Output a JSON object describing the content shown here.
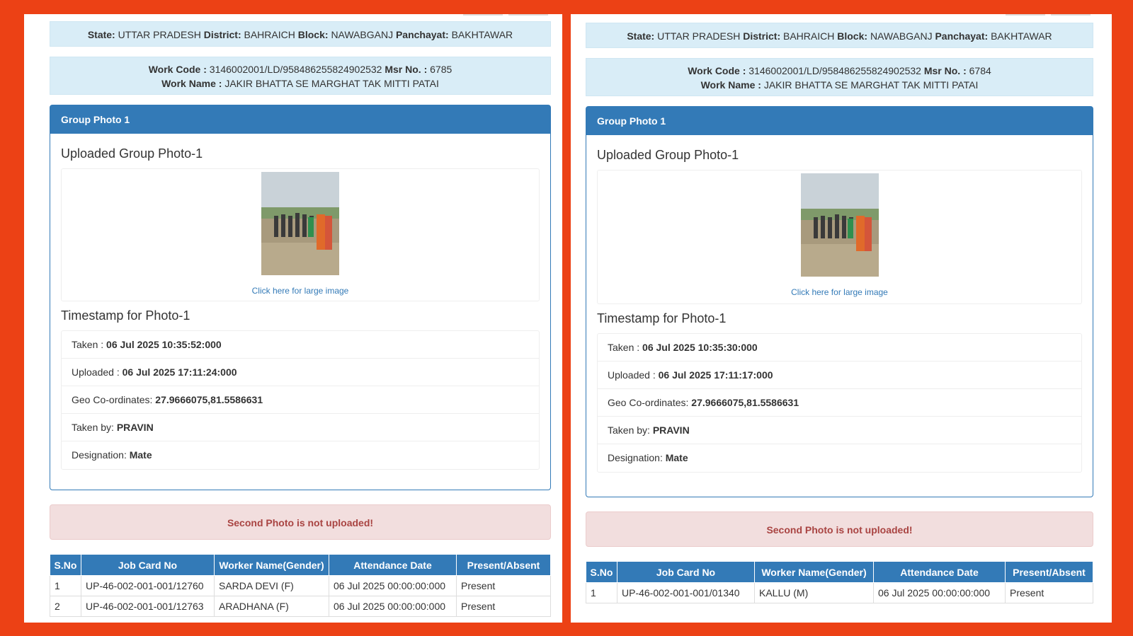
{
  "panels": [
    {
      "location": {
        "state_label": "State:",
        "state": "UTTAR PRADESH",
        "district_label": "District:",
        "district": "BAHRAICH",
        "block_label": "Block:",
        "block": "NAWABGANJ",
        "panchayat_label": "Panchayat:",
        "panchayat": "BAKHTAWAR"
      },
      "work": {
        "code_label": "Work Code :",
        "code": "3146002001/LD/958486255824902532",
        "msr_label": "Msr No. :",
        "msr": "6785",
        "name_label": "Work Name :",
        "name": "JAKIR BHATTA SE MARGHAT TAK MITTI PATAI"
      },
      "card_title": "Group Photo 1",
      "uploaded_title": "Uploaded Group Photo-1",
      "photo_link": "Click here for large image",
      "timestamp_title": "Timestamp for Photo-1",
      "taken_label": "Taken :",
      "taken": "06 Jul 2025 10:35:52:000",
      "uploaded_label": "Uploaded :",
      "uploaded": "06 Jul 2025 17:11:24:000",
      "geo_label": "Geo Co-ordinates:",
      "geo": "27.9666075,81.5586631",
      "takenby_label": "Taken by:",
      "takenby": "PRAVIN",
      "designation_label": "Designation:",
      "designation": "Mate",
      "alert": "Second Photo is not uploaded!",
      "table_headers": [
        "S.No",
        "Job Card No",
        "Worker Name(Gender)",
        "Attendance Date",
        "Present/Absent"
      ],
      "rows": [
        [
          "1",
          "UP-46-002-001-001/12760",
          "SARDA DEVI (F)",
          "06 Jul 2025 00:00:00:000",
          "Present"
        ],
        [
          "2",
          "UP-46-002-001-001/12763",
          "ARADHANA (F)",
          "06 Jul 2025 00:00:00:000",
          "Present"
        ]
      ]
    },
    {
      "location": {
        "state_label": "State:",
        "state": "UTTAR PRADESH",
        "district_label": "District:",
        "district": "BAHRAICH",
        "block_label": "Block:",
        "block": "NAWABGANJ",
        "panchayat_label": "Panchayat:",
        "panchayat": "BAKHTAWAR"
      },
      "work": {
        "code_label": "Work Code :",
        "code": "3146002001/LD/958486255824902532",
        "msr_label": "Msr No. :",
        "msr": "6784",
        "name_label": "Work Name :",
        "name": "JAKIR BHATTA SE MARGHAT TAK MITTI PATAI"
      },
      "card_title": "Group Photo 1",
      "uploaded_title": "Uploaded Group Photo-1",
      "photo_link": "Click here for large image",
      "timestamp_title": "Timestamp for Photo-1",
      "taken_label": "Taken :",
      "taken": "06 Jul 2025 10:35:30:000",
      "uploaded_label": "Uploaded :",
      "uploaded": "06 Jul 2025 17:11:17:000",
      "geo_label": "Geo Co-ordinates:",
      "geo": "27.9666075,81.5586631",
      "takenby_label": "Taken by:",
      "takenby": "PRAVIN",
      "designation_label": "Designation:",
      "designation": "Mate",
      "alert": "Second Photo is not uploaded!",
      "table_headers": [
        "S.No",
        "Job Card No",
        "Worker Name(Gender)",
        "Attendance Date",
        "Present/Absent"
      ],
      "rows": [
        [
          "1",
          "UP-46-002-001-001/01340",
          "KALLU (M)",
          "06 Jul 2025 00:00:00:000",
          "Present"
        ]
      ]
    }
  ],
  "colors": {
    "frame": "#ec4115",
    "primary": "#337ab7",
    "info_bg": "#d9edf7",
    "alert_bg": "#f2dede",
    "alert_text": "#a94442"
  }
}
